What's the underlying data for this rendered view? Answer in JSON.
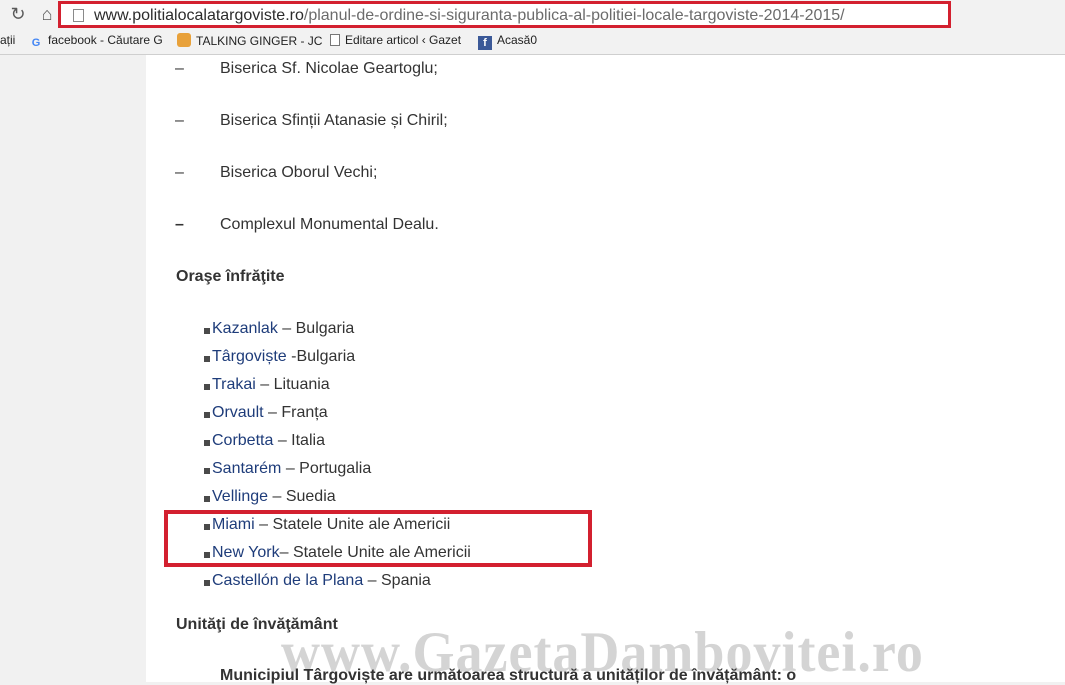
{
  "browser": {
    "url_domain": "www.politialocalatargoviste.ro",
    "url_path": "/planul-de-ordine-si-siguranta-publica-al-politiei-locale-targoviste-2014-2015/",
    "bookmarks": [
      {
        "label": "ații"
      },
      {
        "icon": "G",
        "label": "facebook - Căutare G"
      },
      {
        "label": "TALKING GINGER - JC"
      },
      {
        "label": "Editare articol ‹ Gazet"
      },
      {
        "icon": "f",
        "label": "Acasă0"
      }
    ]
  },
  "content": {
    "churches": [
      {
        "dash": "–",
        "text": "Biserica Sf. Nicolae Geartoglu;"
      },
      {
        "dash": "–",
        "text": "Biserica Sfinții Atanasie și Chiril;"
      },
      {
        "dash": "–",
        "text": "Biserica Oborul Vechi;"
      },
      {
        "dash": "–",
        "text": "Complexul Monumental Dealu."
      }
    ],
    "twin_heading": "Oraşe înfrăţite",
    "twin_cities": [
      {
        "city": "Kazanlak",
        "country": " – Bulgaria"
      },
      {
        "city": "Târgoviște",
        "country": " -Bulgaria"
      },
      {
        "city": "Trakai",
        "country": " – Lituania"
      },
      {
        "city": "Orvault",
        "country": " – Franța"
      },
      {
        "city": "Corbetta",
        "country": " – Italia"
      },
      {
        "city": "Santarém",
        "country": " – Portugalia"
      },
      {
        "city": "Vellinge",
        "country": " – Suedia"
      },
      {
        "city": "Miami",
        "country": " – Statele Unite ale Americii"
      },
      {
        "city": "New York",
        "country": "– Statele Unite ale Americii"
      },
      {
        "city": "Castellón de la Plana",
        "country": " – Spania"
      }
    ],
    "education_heading": "Unităţi de învăţământ",
    "education_paragraph": "Municipiul Târgoviște are următoarea structură a unităților de învățământ: o",
    "watermark": "www.GazetaDambovitei.ro"
  },
  "colors": {
    "highlight": "#d3202f",
    "link": "#1e3c7a"
  }
}
